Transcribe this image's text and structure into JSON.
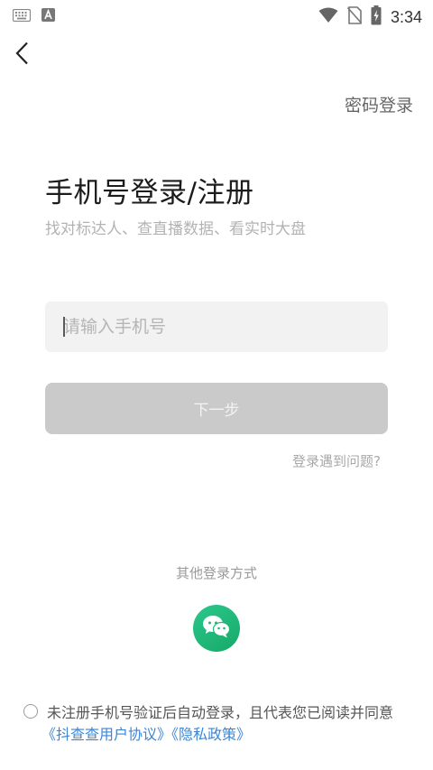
{
  "status_bar": {
    "time": "3:34",
    "icons": [
      "keyboard-icon",
      "a-badge-icon",
      "wifi-icon",
      "no-sim-icon",
      "battery-charging-icon"
    ]
  },
  "nav": {
    "back_icon": "chevron-left-icon",
    "password_login": "密码登录"
  },
  "main": {
    "title": "手机号登录/注册",
    "subtitle": "找对标达人、查直播数据、看实时大盘",
    "phone_placeholder": "请输入手机号",
    "phone_value": "",
    "next_button": "下一步",
    "trouble_link": "登录遇到问题?"
  },
  "other_login": {
    "label": "其他登录方式",
    "wechat_icon": "wechat-icon"
  },
  "agreement": {
    "text": "未注册手机号验证后自动登录，且代表您已阅读并同意",
    "user_agreement": "《抖查查用户协议》",
    "privacy_policy": "《隐私政策》"
  },
  "colors": {
    "accent_link": "#3b86d6",
    "wechat_green": "#1fb877",
    "disabled_button": "#cacaca",
    "input_bg": "#f2f2f2"
  }
}
